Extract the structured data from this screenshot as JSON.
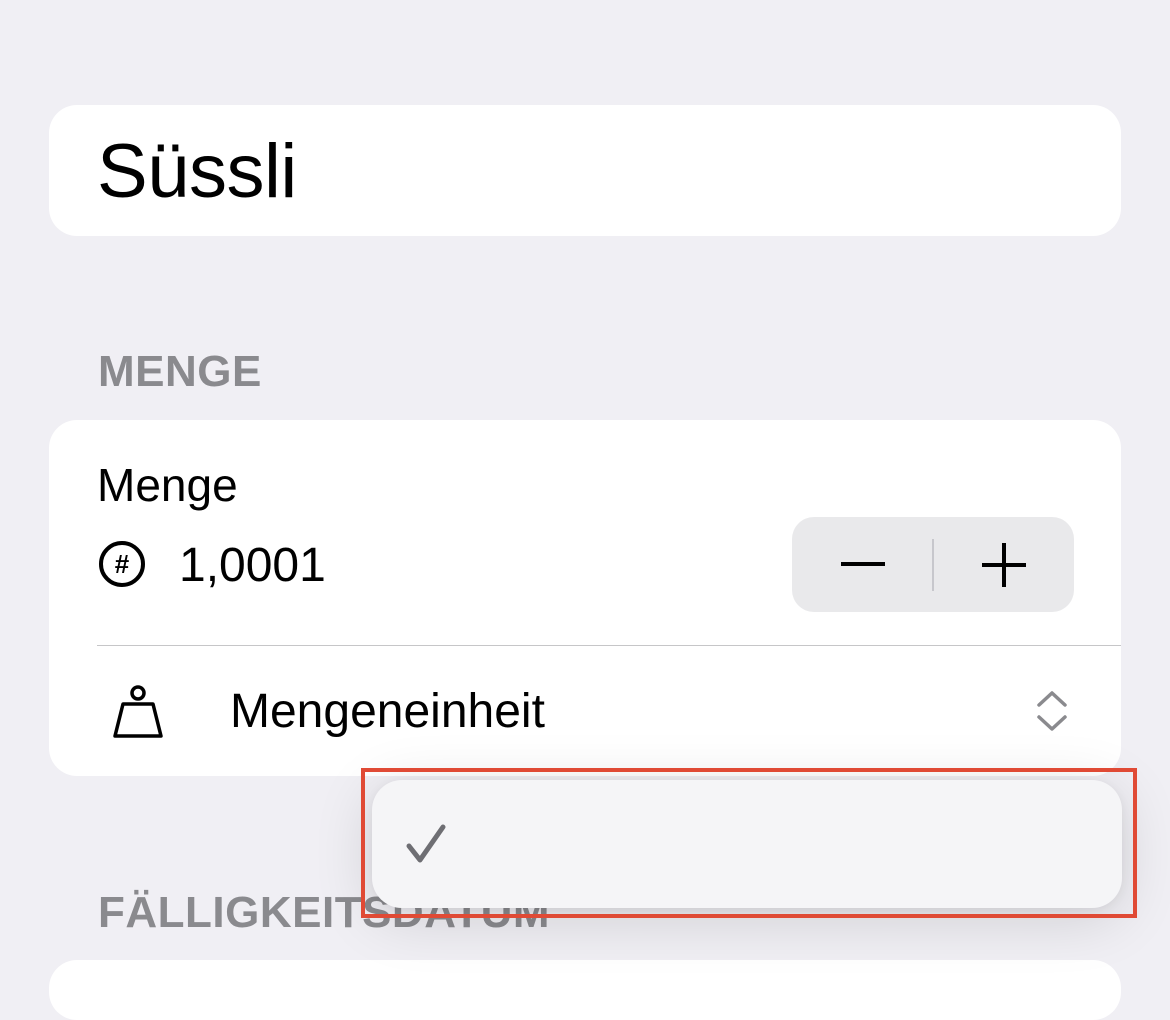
{
  "item": {
    "title": "Süssli"
  },
  "sections": {
    "quantity_header": "MENGE",
    "due_date_header": "FÄLLIGKEITSDATUM"
  },
  "quantity": {
    "label": "Menge",
    "value": "1,0001",
    "minus_symbol": "−",
    "plus_symbol": "+",
    "icon": "number-circle-icon"
  },
  "unit": {
    "label": "Mengeneinheit",
    "icon": "weight-icon",
    "selector_icon": "chevron-up-down-icon"
  },
  "unit_menu": {
    "items": [
      {
        "label": "",
        "selected": true
      }
    ],
    "check_icon": "checkmark-icon"
  },
  "colors": {
    "background": "#f0eff4",
    "card": "#ffffff",
    "section_header": "#8a8a8e",
    "stepper_bg": "#e9e9eb",
    "highlight": "#e04a35"
  }
}
